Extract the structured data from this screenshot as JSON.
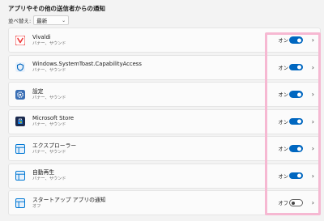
{
  "section": {
    "title": "アプリやその他の送信者からの通知"
  },
  "sort": {
    "label": "並べ替え:",
    "selected": "最新"
  },
  "apps": [
    {
      "name": "Vivaldi",
      "sub": "バナー、サウンド",
      "state": "オン",
      "on": true,
      "icon": "vivaldi-icon",
      "color": "#ef3939"
    },
    {
      "name": "Windows.SystemToast.CapabilityAccess",
      "sub": "バナー、サウンド",
      "state": "オン",
      "on": true,
      "icon": "shield-icon",
      "color": "#0067c0"
    },
    {
      "name": "設定",
      "sub": "バナー、サウンド",
      "state": "オン",
      "on": true,
      "icon": "gear-icon",
      "color": "#2b6cb0"
    },
    {
      "name": "Microsoft Store",
      "sub": "バナー、サウンド",
      "state": "オン",
      "on": true,
      "icon": "store-icon",
      "color": "#1e3a8a"
    },
    {
      "name": "エクスプローラー",
      "sub": "バナー、サウンド",
      "state": "オン",
      "on": true,
      "icon": "window-icon",
      "color": "#0078d4"
    },
    {
      "name": "自動再生",
      "sub": "バナー、サウンド",
      "state": "オン",
      "on": true,
      "icon": "window-icon",
      "color": "#0078d4"
    },
    {
      "name": "スタートアップ アプリの通知",
      "sub": "オフ",
      "state": "オフ",
      "on": false,
      "icon": "window-icon",
      "color": "#0078d4"
    }
  ],
  "colors": {
    "accent": "#0067c0",
    "highlight": "#f6b8d2"
  }
}
